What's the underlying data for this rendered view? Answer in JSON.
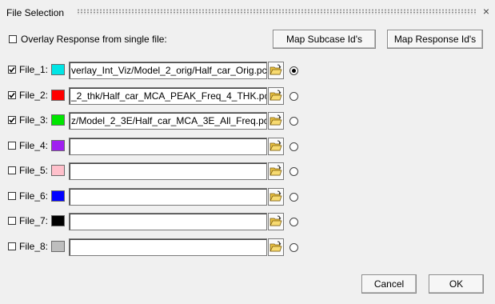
{
  "window": {
    "title": "File Selection",
    "close_glyph": "×"
  },
  "overlay": {
    "label": "Overlay Response from single file:",
    "checked": false
  },
  "buttons": {
    "map_subcase": "Map Subcase Id's",
    "map_response": "Map Response Id's",
    "cancel": "Cancel",
    "ok": "OK"
  },
  "files": [
    {
      "label": "File_1:",
      "checked": true,
      "color": "#00e5e5",
      "path": "verlay_Int_Viz/Model_2_orig/Half_car_Orig.pch",
      "selected": true
    },
    {
      "label": "File_2:",
      "checked": true,
      "color": "#ff0000",
      "path": "_2_thk/Half_car_MCA_PEAK_Freq_4_THK.pch",
      "selected": false
    },
    {
      "label": "File_3:",
      "checked": true,
      "color": "#00e600",
      "path": "z/Model_2_3E/Half_car_MCA_3E_All_Freq.pch",
      "selected": false
    },
    {
      "label": "File_4:",
      "checked": false,
      "color": "#a020f0",
      "path": "",
      "selected": false
    },
    {
      "label": "File_5:",
      "checked": false,
      "color": "#ffc0cb",
      "path": "",
      "selected": false
    },
    {
      "label": "File_6:",
      "checked": false,
      "color": "#0000ff",
      "path": "",
      "selected": false
    },
    {
      "label": "File_7:",
      "checked": false,
      "color": "#000000",
      "path": "",
      "selected": false
    },
    {
      "label": "File_8:",
      "checked": false,
      "color": "#bebebe",
      "path": "",
      "selected": false
    }
  ],
  "icons": {
    "browse": "open-folder-icon",
    "check": "checkmark-icon"
  }
}
